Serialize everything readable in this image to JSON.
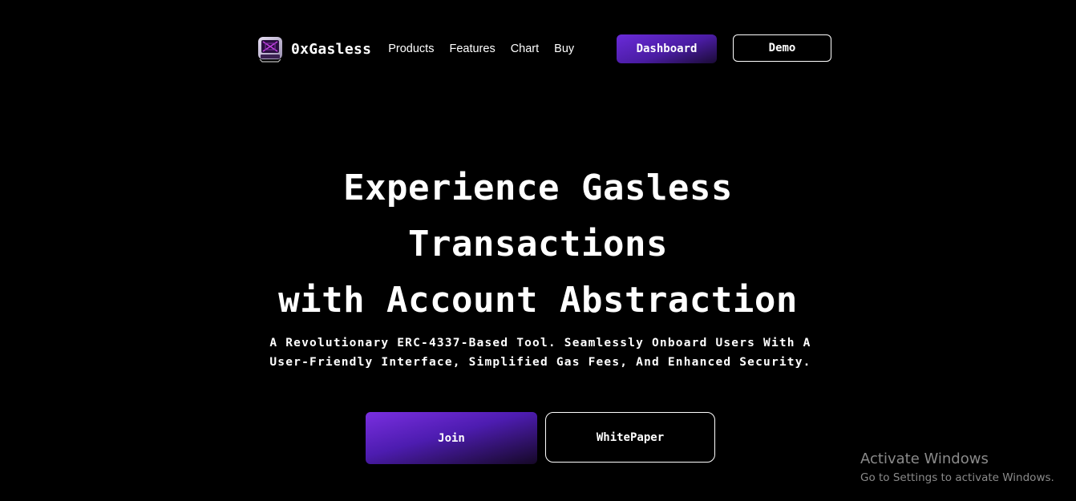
{
  "nav": {
    "logo_text": "0xGasless",
    "links": [
      {
        "label": "Products"
      },
      {
        "label": "Features"
      },
      {
        "label": "Chart"
      },
      {
        "label": "Buy"
      }
    ],
    "dashboard_label": "Dashboard",
    "demo_label": "Demo"
  },
  "hero": {
    "title_line1": "Experience Gasless",
    "title_line2": "Transactions",
    "title_line3": "with Account Abstraction",
    "subtitle": "A Revolutionary ERC-4337-Based Tool. Seamlessly Onboard Users With A User-Friendly Interface, Simplified Gas Fees, And Enhanced Security.",
    "join_label": "Join",
    "whitepaper_label": "WhitePaper"
  },
  "watermark": {
    "title": "Activate Windows",
    "subtitle": "Go to Settings to activate Windows."
  },
  "colors": {
    "background": "#000000",
    "accent": "#5b22c8",
    "text": "#ffffff",
    "watermark": "#8a8a8a"
  }
}
